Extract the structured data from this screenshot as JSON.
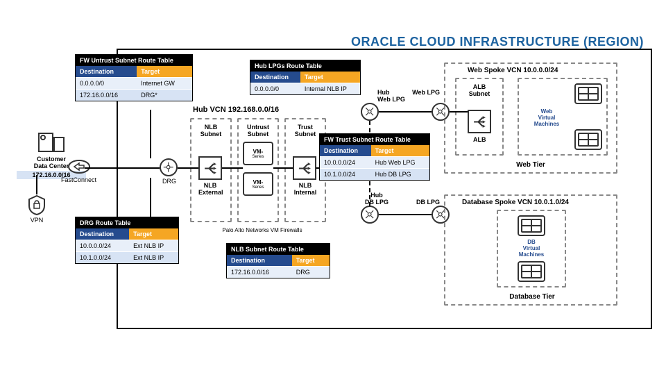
{
  "region_title": "ORACLE CLOUD INFRASTRUCTURE (REGION)",
  "onprem": {
    "datacenter_label": "Customer\nData Center",
    "datacenter_cidr": "172.16.0.0/16",
    "fastconnect_label": "FastConnect",
    "vpn_label": "VPN"
  },
  "hub_vcn_label": "Hub VCN 192.168.0.0/16",
  "subnets": {
    "nlb": "NLB\nSubnet",
    "untrust": "Untrust\nSubnet",
    "trust": "Trust\nSubnet"
  },
  "icons": {
    "drg": "DRG",
    "nlb_external": "NLB\nExternal",
    "nlb_internal": "NLB\nInternal",
    "vm_series": "VM-",
    "vm_series_sub": "Series",
    "hub_web_lpg": "Hub\nWeb LPG",
    "hub_db_lpg": "Hub\nDB LPG",
    "web_lpg": "Web LPG",
    "db_lpg": "DB LPG",
    "alb_subnet": "ALB\nSubnet",
    "alb": "ALB",
    "palo_alto": "Palo Alto Networks VM Firewalls"
  },
  "web_spoke": {
    "title": "Web Spoke VCN 10.0.0.0/24",
    "vm_label": "Web\nVirtual\nMachines",
    "caption": "Web Tier"
  },
  "db_spoke": {
    "title": "Database Spoke VCN 10.0.1.0/24",
    "vm_label": "DB\nVirtual\nMachines",
    "caption": "Database Tier"
  },
  "tables": {
    "fw_untrust": {
      "title": "FW Untrust Subnet Route Table",
      "headers": [
        "Destination",
        "Target"
      ],
      "rows": [
        [
          "0.0.0.0/0",
          "Internet GW"
        ],
        [
          "172.16.0.0/16",
          "DRG*"
        ]
      ]
    },
    "hub_lpgs": {
      "title": "Hub LPGs Route Table",
      "headers": [
        "Destination",
        "Target"
      ],
      "rows": [
        [
          "0.0.0.0/0",
          "Internal NLB IP"
        ]
      ]
    },
    "fw_trust": {
      "title": "FW Trust Subnet Route Table",
      "headers": [
        "Destination",
        "Target"
      ],
      "rows": [
        [
          "10.0.0.0/24",
          "Hub Web LPG"
        ],
        [
          "10.1.0.0/24",
          "Hub DB LPG"
        ]
      ]
    },
    "drg": {
      "title": "DRG Route Table",
      "headers": [
        "Destination",
        "Target"
      ],
      "rows": [
        [
          "10.0.0.0/24",
          "Ext NLB IP"
        ],
        [
          "10.1.0.0/24",
          "Ext NLB IP"
        ]
      ]
    },
    "nlb_subnet": {
      "title": "NLB Subnet Route Table",
      "headers": [
        "Destination",
        "Target"
      ],
      "rows": [
        [
          "172.16.0.0/16",
          "DRG"
        ]
      ]
    }
  }
}
